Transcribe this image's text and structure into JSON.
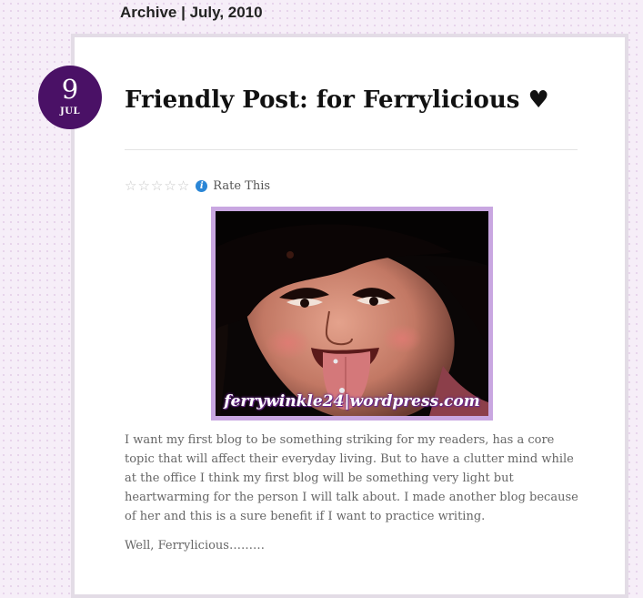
{
  "archive": {
    "heading": "Archive | July, 2010"
  },
  "post": {
    "date": {
      "day": "9",
      "month": "JUL"
    },
    "title": "Friendly Post: for Ferrylicious ♥",
    "rating": {
      "label": "Rate This",
      "stars": 5,
      "filled": 0
    },
    "image": {
      "watermark": "ferrywinkle24|wordpress.com",
      "alt_icon": "photo"
    },
    "paragraphs": [
      "I want my first blog to be something striking for my readers, has a core topic that will affect their everyday living. But to have a clutter mind while at the office I think my first blog will be something very light but heartwarming for the person I will talk about. I made another blog because of her and this is a sure benefit if I want to practice writing.",
      "Well, Ferrylicious………"
    ]
  },
  "colors": {
    "badge": "#4a1166",
    "image_border": "#c9a7e1",
    "info_icon": "#2a86d6"
  }
}
